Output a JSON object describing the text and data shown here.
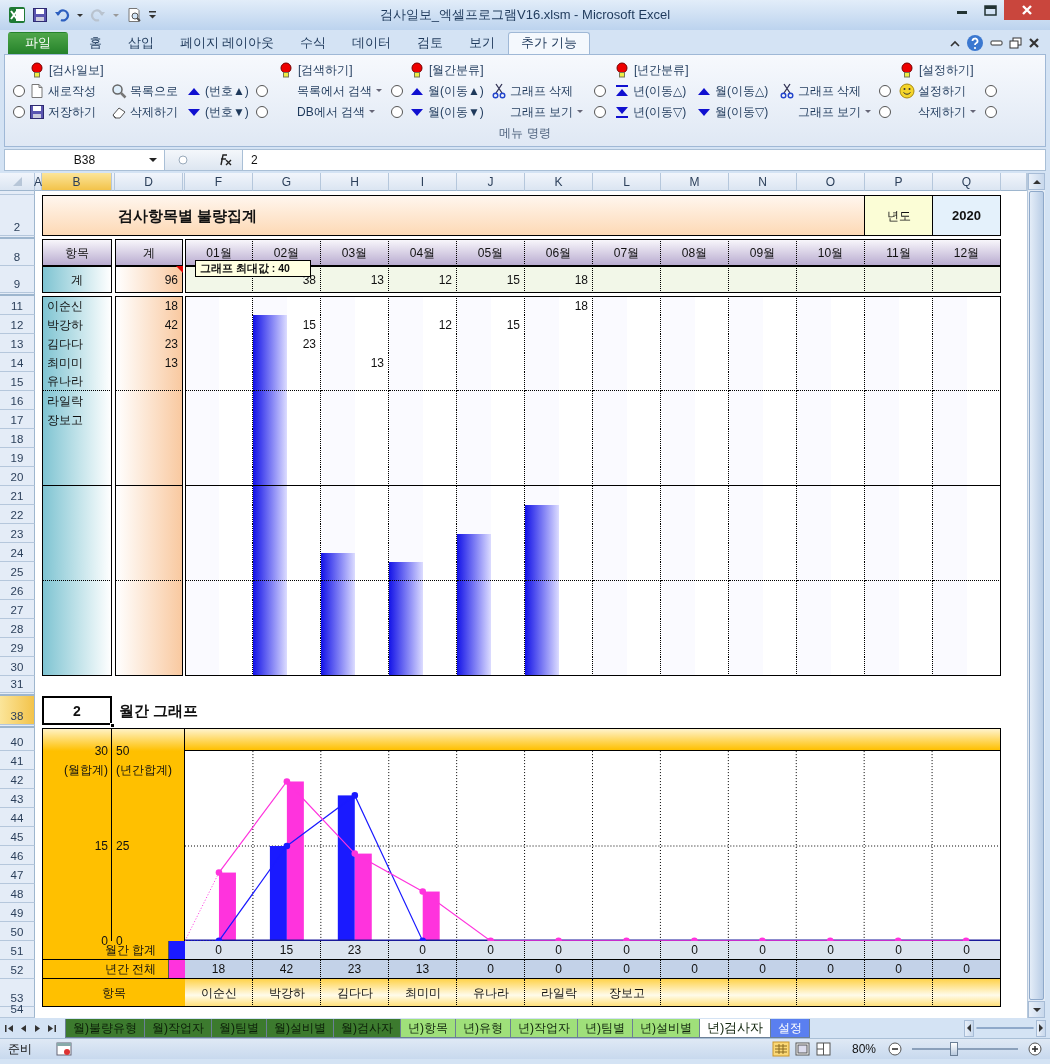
{
  "window": {
    "title": "검사일보_엑셀프로그램V16.xlsm  -  Microsoft Excel"
  },
  "ribbon_tabs": [
    {
      "label": "파일",
      "kind": "file",
      "selected": false
    },
    {
      "label": "홈",
      "kind": "tab",
      "selected": false
    },
    {
      "label": "삽입",
      "kind": "tab",
      "selected": false
    },
    {
      "label": "페이지 레이아웃",
      "kind": "tab",
      "selected": false
    },
    {
      "label": "수식",
      "kind": "tab",
      "selected": false
    },
    {
      "label": "데이터",
      "kind": "tab",
      "selected": false
    },
    {
      "label": "검토",
      "kind": "tab",
      "selected": false
    },
    {
      "label": "보기",
      "kind": "tab",
      "selected": false
    },
    {
      "label": "추가 기능",
      "kind": "tab",
      "selected": true
    }
  ],
  "ribbon": {
    "columns": [
      [
        null,
        {
          "kind": "radio",
          "checked": false
        },
        {
          "kind": "radio",
          "checked": false
        }
      ],
      [
        {
          "kind": "title",
          "label": "[검사일보]"
        },
        {
          "kind": "button",
          "label": "새로작성",
          "dropdown": false
        },
        {
          "kind": "button",
          "label": "저장하기",
          "dropdown": false
        }
      ],
      [
        null,
        {
          "kind": "button",
          "label": "목록으로",
          "dropdown": false
        },
        {
          "kind": "button",
          "label": "삭제하기",
          "dropdown": false
        }
      ],
      [
        null,
        {
          "kind": "button",
          "label": "(번호▲)",
          "dropdown": false
        },
        {
          "kind": "button",
          "label": "(번호▼)",
          "dropdown": false
        }
      ],
      [
        null,
        {
          "kind": "radio",
          "checked": false
        },
        {
          "kind": "radio",
          "checked": false
        }
      ],
      [
        {
          "kind": "title",
          "label": "[검색하기]"
        },
        {
          "kind": "button",
          "label": "목록에서 검색",
          "dropdown": true
        },
        {
          "kind": "button",
          "label": "DB에서 검색",
          "dropdown": true
        }
      ],
      [
        null,
        {
          "kind": "radio",
          "checked": false
        },
        {
          "kind": "radio",
          "checked": false
        }
      ],
      [
        {
          "kind": "title",
          "label": "[월간분류]"
        },
        {
          "kind": "button",
          "label": "월(이동▲)",
          "dropdown": false
        },
        {
          "kind": "button",
          "label": "월(이동▼)",
          "dropdown": false
        }
      ],
      [
        null,
        {
          "kind": "button",
          "label": "그래프 삭제",
          "dropdown": false
        },
        {
          "kind": "button",
          "label": "그래프 보기",
          "dropdown": true
        }
      ],
      [
        null,
        {
          "kind": "radio",
          "checked": false
        },
        {
          "kind": "radio",
          "checked": false
        }
      ],
      [
        {
          "kind": "title",
          "label": "[년간분류]"
        },
        {
          "kind": "button",
          "label": "년(이동△)",
          "dropdown": false
        },
        {
          "kind": "button",
          "label": "년(이동▽)",
          "dropdown": false
        }
      ],
      [
        null,
        {
          "kind": "button",
          "label": "월(이동△)",
          "dropdown": false
        },
        {
          "kind": "button",
          "label": "월(이동▽)",
          "dropdown": false
        }
      ],
      [
        null,
        {
          "kind": "button",
          "label": "그래프 삭제",
          "dropdown": false
        },
        {
          "kind": "button",
          "label": "그래프 보기",
          "dropdown": true
        }
      ],
      [
        null,
        {
          "kind": "radio",
          "checked": false
        },
        {
          "kind": "radio",
          "checked": false
        }
      ],
      [
        {
          "kind": "title",
          "label": "[설정하기]"
        },
        {
          "kind": "button",
          "label": "설정하기",
          "dropdown": false
        },
        {
          "kind": "button",
          "label": "삭제하기",
          "dropdown": true
        }
      ],
      [
        null,
        {
          "kind": "radio",
          "checked": false
        },
        {
          "kind": "radio",
          "checked": false
        }
      ]
    ],
    "group_label": "메뉴 명령"
  },
  "formula_bar": {
    "name_box": "B38",
    "formula": "2"
  },
  "column_headers": [
    {
      "label": "A",
      "selected": false
    },
    {
      "label": "B",
      "selected": true
    },
    {
      "label": "D",
      "selected": false
    },
    {
      "label": "F",
      "selected": false
    },
    {
      "label": "G",
      "selected": false
    },
    {
      "label": "H",
      "selected": false
    },
    {
      "label": "I",
      "selected": false
    },
    {
      "label": "J",
      "selected": false
    },
    {
      "label": "K",
      "selected": false
    },
    {
      "label": "L",
      "selected": false
    },
    {
      "label": "M",
      "selected": false
    },
    {
      "label": "N",
      "selected": false
    },
    {
      "label": "O",
      "selected": false
    },
    {
      "label": "P",
      "selected": false
    },
    {
      "label": "Q",
      "selected": false
    }
  ],
  "row_headers": [
    {
      "label": "2",
      "selected": false
    },
    {
      "label": "8",
      "selected": false
    },
    {
      "label": "9",
      "selected": false
    },
    {
      "label": "11",
      "selected": false
    },
    {
      "label": "12",
      "selected": false
    },
    {
      "label": "13",
      "selected": false
    },
    {
      "label": "14",
      "selected": false
    },
    {
      "label": "15",
      "selected": false
    },
    {
      "label": "16",
      "selected": false
    },
    {
      "label": "17",
      "selected": false
    },
    {
      "label": "18",
      "selected": false
    },
    {
      "label": "19",
      "selected": false
    },
    {
      "label": "20",
      "selected": false
    },
    {
      "label": "21",
      "selected": false
    },
    {
      "label": "22",
      "selected": false
    },
    {
      "label": "23",
      "selected": false
    },
    {
      "label": "24",
      "selected": false
    },
    {
      "label": "25",
      "selected": false
    },
    {
      "label": "26",
      "selected": false
    },
    {
      "label": "27",
      "selected": false
    },
    {
      "label": "28",
      "selected": false
    },
    {
      "label": "29",
      "selected": false
    },
    {
      "label": "30",
      "selected": false
    },
    {
      "label": "31",
      "selected": false
    },
    {
      "label": "38",
      "selected": true
    },
    {
      "label": "40",
      "selected": false
    },
    {
      "label": "41",
      "selected": false
    },
    {
      "label": "42",
      "selected": false
    },
    {
      "label": "43",
      "selected": false
    },
    {
      "label": "44",
      "selected": false
    },
    {
      "label": "45",
      "selected": false
    },
    {
      "label": "46",
      "selected": false
    },
    {
      "label": "47",
      "selected": false
    },
    {
      "label": "48",
      "selected": false
    },
    {
      "label": "49",
      "selected": false
    },
    {
      "label": "50",
      "selected": false
    },
    {
      "label": "51",
      "selected": false
    },
    {
      "label": "52",
      "selected": false
    },
    {
      "label": "53",
      "selected": false
    },
    {
      "label": "54",
      "selected": false
    }
  ],
  "summary": {
    "title": "검사항목별 불량집계",
    "year_label": "년도",
    "year": "2020",
    "item_header": "항목",
    "total_header": "계",
    "months": [
      {
        "label": "01월",
        "level": 0
      },
      {
        "label": "02월",
        "level": 0.95
      },
      {
        "label": "03월",
        "level": 0.325
      },
      {
        "label": "04월",
        "level": 0.3
      },
      {
        "label": "05월",
        "level": 0.375
      },
      {
        "label": "06월",
        "level": 0.45
      },
      {
        "label": "07월",
        "level": 0
      },
      {
        "label": "08월",
        "level": 0
      },
      {
        "label": "09월",
        "level": 0
      },
      {
        "label": "10월",
        "level": 0
      },
      {
        "label": "11월",
        "level": 0
      },
      {
        "label": "12월",
        "level": 0
      }
    ],
    "total_row": {
      "label": "계",
      "total": "96",
      "cells": [
        null,
        "38",
        "13",
        "12",
        "15",
        "18",
        null,
        null,
        null,
        null,
        null,
        null
      ]
    },
    "rows": [
      {
        "label": "이순신",
        "total": "18",
        "cells": [
          null,
          null,
          null,
          null,
          null,
          "18",
          null,
          null,
          null,
          null,
          null,
          null
        ]
      },
      {
        "label": "박강하",
        "total": "42",
        "cells": [
          null,
          "15",
          null,
          "12",
          "15",
          null,
          null,
          null,
          null,
          null,
          null,
          null
        ]
      },
      {
        "label": "김다다",
        "total": "23",
        "cells": [
          null,
          "23",
          null,
          null,
          null,
          null,
          null,
          null,
          null,
          null,
          null,
          null
        ]
      },
      {
        "label": "최미미",
        "total": "13",
        "cells": [
          null,
          null,
          "13",
          null,
          null,
          null,
          null,
          null,
          null,
          null,
          null,
          null
        ]
      },
      {
        "label": "유나라"
      },
      {
        "label": "라일락"
      },
      {
        "label": "장보고"
      },
      {},
      {},
      {},
      {},
      {},
      {},
      {},
      {},
      {},
      {},
      {},
      {},
      {}
    ],
    "note": "그래프 최대값 : 40"
  },
  "monthly_graph": {
    "selector": "2",
    "title": "월간 그래프",
    "category_header": "항목",
    "chart_data": {
      "type": "bar",
      "legend": "left",
      "ylabel": "(월합계)",
      "ylim": [
        0,
        30
      ],
      "yticks": [
        0,
        15,
        30
      ],
      "y2label": "(년간합계)",
      "y2lim": [
        0,
        50
      ],
      "y2ticks": [
        0,
        25,
        50
      ],
      "categories": [
        "이순신",
        "박강하",
        "김다다",
        "최미미",
        "유나라",
        "라일락",
        "장보고",
        null,
        null,
        null,
        null,
        null
      ],
      "series": [
        {
          "name": "월간 합계",
          "color": "#1a1aff",
          "values": [
            0,
            15,
            23,
            0,
            null,
            null,
            null,
            null,
            null,
            null,
            null,
            null
          ]
        },
        {
          "name": "년간 전체",
          "color": "#ff33dd",
          "axis": "y2",
          "values": [
            18,
            42,
            23,
            13,
            0,
            0,
            0,
            0,
            0,
            0,
            0,
            0
          ]
        }
      ]
    },
    "monthly_row": [
      "0",
      "15",
      "23",
      "0",
      "0",
      "0",
      "0",
      "0",
      "0",
      "0",
      "0",
      "0"
    ],
    "yearly_row": [
      "18",
      "42",
      "23",
      "13",
      "0",
      "0",
      "0",
      "0",
      "0",
      "0",
      "0",
      "0"
    ]
  },
  "sheet_tabs": [
    {
      "label": "월)불량유형",
      "color": "#3c7a2e",
      "selected": false
    },
    {
      "label": "월)작업자",
      "color": "#3c7a2e",
      "selected": false
    },
    {
      "label": "월)팀별",
      "color": "#3c7a2e",
      "selected": false
    },
    {
      "label": "월)설비별",
      "color": "#3c7a2e",
      "selected": false
    },
    {
      "label": "월)검사자",
      "color": "#3c7a2e",
      "selected": false
    },
    {
      "label": "년)항목",
      "color": "#9fe07a",
      "selected": false
    },
    {
      "label": "년)유형",
      "color": "#9fe07a",
      "selected": false
    },
    {
      "label": "년)작업자",
      "color": "#9fe07a",
      "selected": false
    },
    {
      "label": "년)팀별",
      "color": "#9fe07a",
      "selected": false
    },
    {
      "label": "년)설비별",
      "color": "#9fe07a",
      "selected": false
    },
    {
      "label": "년)검사자",
      "color": "#ffffff",
      "selected": true
    },
    {
      "label": "설정",
      "color": "#5a7ff0",
      "selected": false
    }
  ],
  "status_bar": {
    "text": "준비",
    "zoom": "80%",
    "zoom_slider": {
      "level": 0.4
    }
  }
}
